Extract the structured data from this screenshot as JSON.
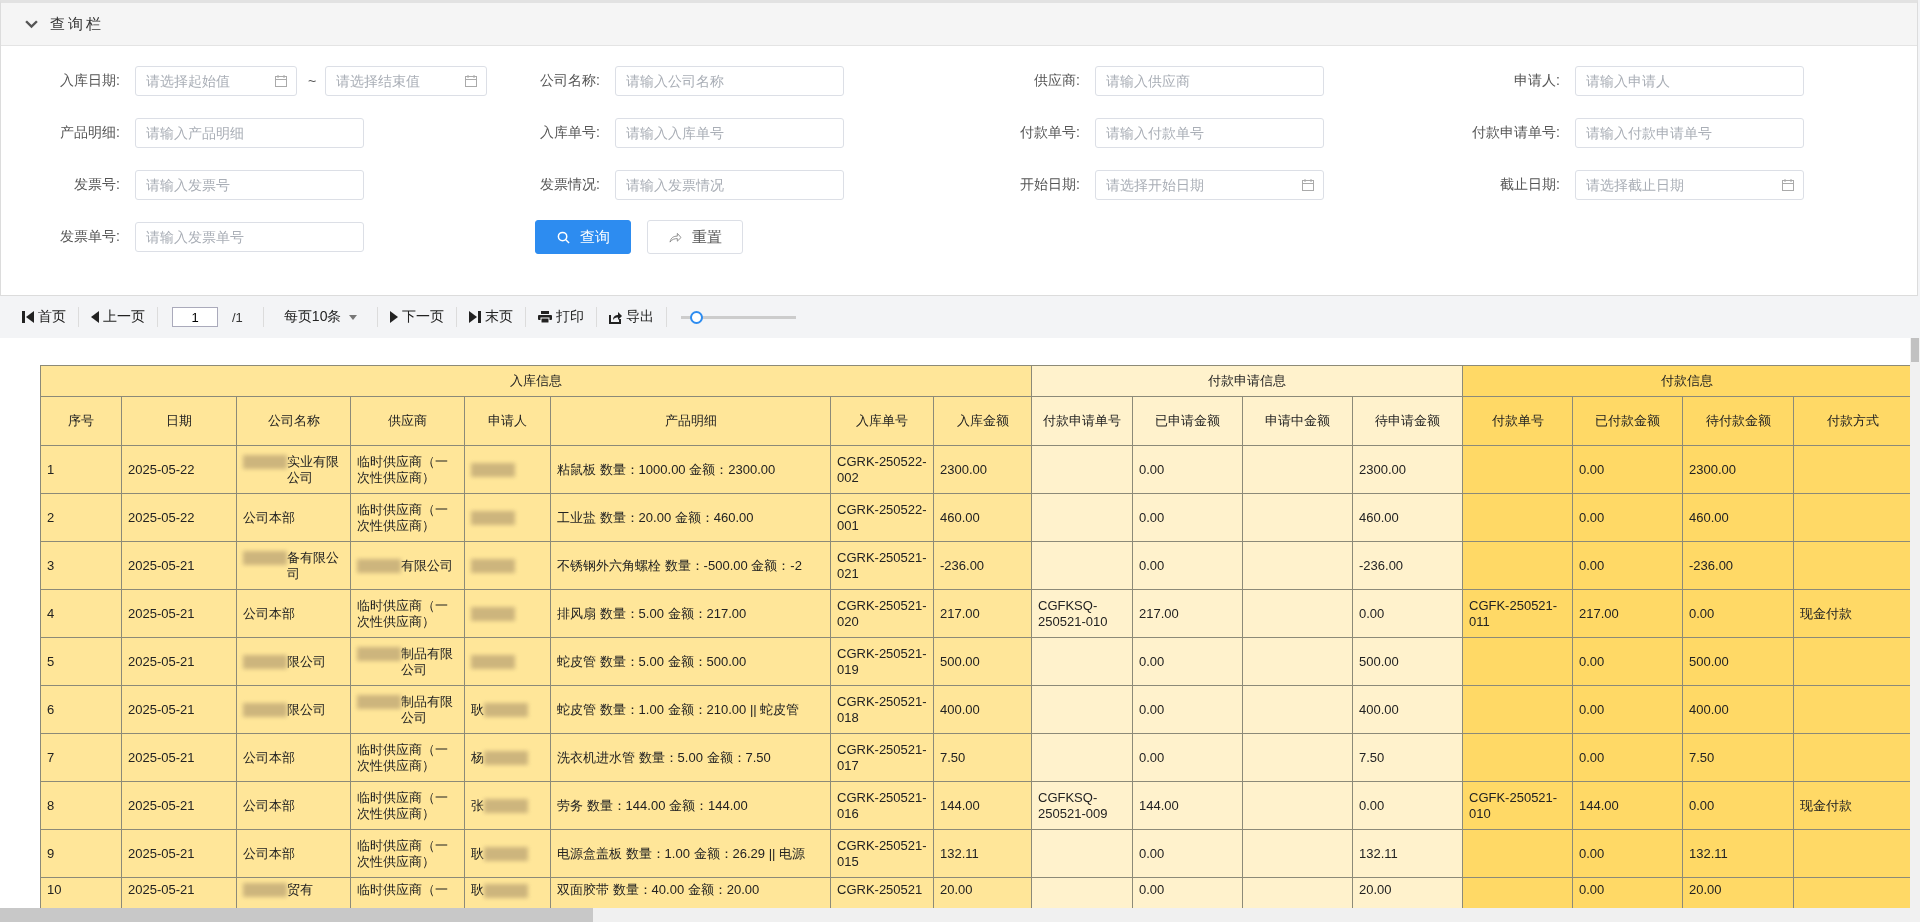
{
  "query_panel": {
    "title": "查询栏",
    "expanded": true,
    "fields": [
      {
        "kind": "daterange",
        "label": "入库日期:",
        "placeholder": "请选择起始值",
        "separator": "~",
        "placeholder_end": "请选择结束值"
      },
      {
        "kind": "text",
        "label": "公司名称:",
        "placeholder": "请输入公司名称"
      },
      {
        "kind": "text",
        "label": "供应商:",
        "placeholder": "请输入供应商"
      },
      {
        "kind": "text",
        "label": "申请人:",
        "placeholder": "请输入申请人"
      },
      {
        "kind": "text",
        "label": "产品明细:",
        "placeholder": "请输入产品明细"
      },
      {
        "kind": "text",
        "label": "入库单号:",
        "placeholder": "请输入入库单号"
      },
      {
        "kind": "text",
        "label": "付款单号:",
        "placeholder": "请输入付款单号"
      },
      {
        "kind": "text",
        "label": "付款申请单号:",
        "placeholder": "请输入付款申请单号"
      },
      {
        "kind": "text",
        "label": "发票号:",
        "placeholder": "请输入发票号"
      },
      {
        "kind": "text",
        "label": "发票情况:",
        "placeholder": "请输入发票情况"
      },
      {
        "kind": "date",
        "label": "开始日期:",
        "placeholder": "请选择开始日期"
      },
      {
        "kind": "date",
        "label": "截止日期:",
        "placeholder": "请选择截止日期"
      },
      {
        "kind": "text",
        "label": "发票单号:",
        "placeholder": "请输入发票单号"
      }
    ],
    "buttons": [
      {
        "kind": "primary",
        "label": "查询"
      },
      {
        "kind": "plain",
        "label": "重置"
      }
    ]
  },
  "toolbar": [
    {
      "kind": "first",
      "label": "首页"
    },
    {
      "kind": "prev",
      "label": "上一页"
    },
    {
      "kind": "page",
      "value": "1",
      "total": "/1"
    },
    {
      "kind": "select",
      "label": "每页10条"
    },
    {
      "kind": "next",
      "label": "下一页"
    },
    {
      "kind": "last",
      "label": "末页"
    },
    {
      "kind": "print",
      "label": "打印"
    },
    {
      "kind": "export",
      "label": "导出"
    },
    {
      "kind": "slider",
      "level": 0.12
    }
  ],
  "table": {
    "groups": [
      {
        "label": "入库信息",
        "color": "#ffe699",
        "columns": [
          "序号",
          "日期",
          "公司名称",
          "供应商",
          "申请人",
          "产品明细",
          "入库单号",
          "入库金额"
        ]
      },
      {
        "label": "付款申请信息",
        "color": "#fff2cc",
        "columns": [
          "付款申请单号",
          "已申请金额",
          "申请中金额",
          "待申请金额"
        ]
      },
      {
        "label": "付款信息",
        "color": "#ffd966",
        "columns": [
          "付款单号",
          "已付款金额",
          "待付款金额",
          "付款方式"
        ]
      }
    ],
    "rows": [
      {
        "cells": [
          "1",
          "2025-05-22",
          {
            "text": "实业有限公司",
            "kind": "blur_before"
          },
          "临时供应商（一次性供应商）",
          {
            "kind": "blur_before"
          },
          "粘鼠板 数量：1000.00 金额：2300.00",
          "CGRK-250522-002",
          "2300.00",
          null,
          "0.00",
          null,
          "2300.00",
          null,
          "0.00",
          "2300.00",
          null
        ]
      },
      {
        "cells": [
          "2",
          "2025-05-22",
          "公司本部",
          "临时供应商（一次性供应商）",
          {
            "kind": "blur_before"
          },
          "工业盐 数量：20.00 金额：460.00",
          "CGRK-250522-001",
          "460.00",
          null,
          "0.00",
          null,
          "460.00",
          null,
          "0.00",
          "460.00",
          null
        ]
      },
      {
        "cells": [
          "3",
          "2025-05-21",
          {
            "text": "备有限公司",
            "kind": "blur_before"
          },
          {
            "text": "有限公司",
            "kind": "blur_before"
          },
          {
            "kind": "blur_before"
          },
          "不锈钢外六角螺栓 数量：-500.00 金额：-2",
          "CGRK-250521-021",
          "-236.00",
          null,
          "0.00",
          null,
          "-236.00",
          null,
          "0.00",
          "-236.00",
          null
        ]
      },
      {
        "cells": [
          "4",
          "2025-05-21",
          "公司本部",
          "临时供应商（一次性供应商）",
          {
            "kind": "blur_before"
          },
          "排风扇 数量：5.00 金额：217.00",
          "CGRK-250521-020",
          "217.00",
          "CGFKSQ-250521-010",
          "217.00",
          null,
          "0.00",
          "CGFK-250521-011",
          "217.00",
          "0.00",
          "现金付款"
        ]
      },
      {
        "cells": [
          "5",
          "2025-05-21",
          {
            "text": "限公司",
            "kind": "blur_before"
          },
          {
            "text": "制品有限公司",
            "kind": "blur_before"
          },
          {
            "kind": "blur_before"
          },
          "蛇皮管 数量：5.00 金额：500.00",
          "CGRK-250521-019",
          "500.00",
          null,
          "0.00",
          null,
          "500.00",
          null,
          "0.00",
          "500.00",
          null
        ]
      },
      {
        "cells": [
          "6",
          "2025-05-21",
          {
            "text": "限公司",
            "kind": "blur_before"
          },
          {
            "text": "制品有限公司",
            "kind": "blur_before"
          },
          {
            "text": "耿",
            "kind": "blur_after"
          },
          "蛇皮管 数量：1.00 金额：210.00 || 蛇皮管",
          "CGRK-250521-018",
          "400.00",
          null,
          "0.00",
          null,
          "400.00",
          null,
          "0.00",
          "400.00",
          null
        ]
      },
      {
        "cells": [
          "7",
          "2025-05-21",
          "公司本部",
          "临时供应商（一次性供应商）",
          {
            "text": "杨",
            "kind": "blur_after"
          },
          "洗衣机进水管 数量：5.00 金额：7.50",
          "CGRK-250521-017",
          "7.50",
          null,
          "0.00",
          null,
          "7.50",
          null,
          "0.00",
          "7.50",
          null
        ]
      },
      {
        "cells": [
          "8",
          "2025-05-21",
          "公司本部",
          "临时供应商（一次性供应商）",
          {
            "text": "张",
            "kind": "blur_after"
          },
          "劳务 数量：144.00 金额：144.00",
          "CGRK-250521-016",
          "144.00",
          "CGFKSQ-250521-009",
          "144.00",
          null,
          "0.00",
          "CGFK-250521-010",
          "144.00",
          "0.00",
          "现金付款"
        ]
      },
      {
        "cells": [
          "9",
          "2025-05-21",
          "公司本部",
          "临时供应商（一次性供应商）",
          {
            "text": "耿",
            "kind": "blur_after"
          },
          "电源盒盖板 数量：1.00 金额：26.29 || 电源",
          "CGRK-250521-015",
          "132.11",
          null,
          "0.00",
          null,
          "132.11",
          null,
          "0.00",
          "132.11",
          null
        ]
      },
      {
        "cells": [
          "10",
          "2025-05-21",
          {
            "text": "贸有",
            "kind": "blur_before"
          },
          "临时供应商（一",
          {
            "text": "耿",
            "kind": "blur_after"
          },
          "双面胶带 数量：40.00 金额：20.00",
          "CGRK-250521",
          "20.00",
          null,
          "0.00",
          null,
          "20.00",
          null,
          "0.00",
          "20.00",
          null
        ]
      }
    ]
  }
}
